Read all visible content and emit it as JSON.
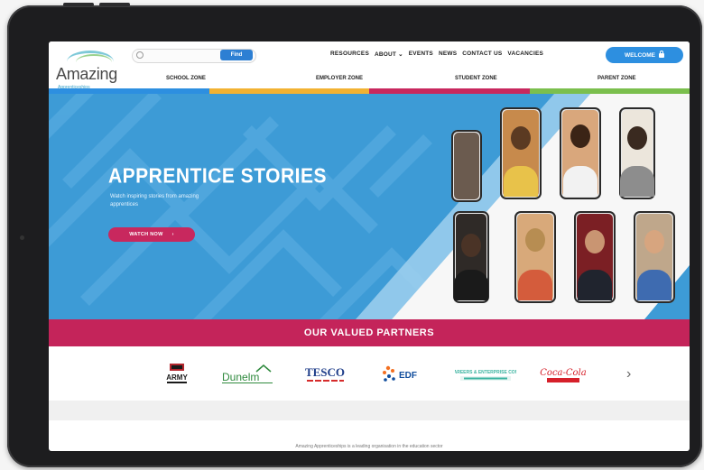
{
  "header": {
    "logo_text": "Amazing",
    "logo_sub": "Apprenticeships",
    "search_placeholder": "",
    "search_button": "Find",
    "nav": [
      "RESOURCES",
      "ABOUT ⌄",
      "EVENTS",
      "NEWS",
      "CONTACT US",
      "VACANCIES"
    ],
    "welcome_label": "WELCOME"
  },
  "zones": [
    "SCHOOL ZONE",
    "EMPLOYER ZONE",
    "STUDENT ZONE",
    "PARENT ZONE"
  ],
  "zone_colors": [
    "#2d8fe0",
    "#f2b233",
    "#c8285e",
    "#7bbf4d"
  ],
  "hero": {
    "title": "APPRENTICE STORIES",
    "subtitle": "Watch inspiring stories from amazing apprentices",
    "cta_label": "WATCH NOW",
    "cta_arrow": "›"
  },
  "partners": {
    "heading": "OUR VALUED PARTNERS",
    "logos": [
      "ARMY",
      "Dunelm",
      "TESCO",
      "EDF",
      "THE CAREERS & ENTERPRISE COMPANY",
      "Coca-Cola"
    ],
    "next_arrow": "›"
  },
  "footer_text": "Amazing Apprenticeships is a leading organisation in the education sector"
}
